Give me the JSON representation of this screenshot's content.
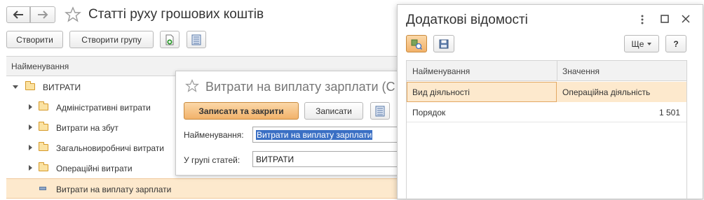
{
  "main": {
    "title": "Статті руху грошових коштів",
    "toolbar": {
      "create_label": "Створити",
      "create_group_label": "Створити групу"
    },
    "column_header": "Найменування",
    "tree": [
      {
        "label": "ВИТРАТИ",
        "type": "group-expanded"
      },
      {
        "label": "Адміністративні витрати",
        "type": "group"
      },
      {
        "label": "Витрати на збут",
        "type": "group"
      },
      {
        "label": "Загальновиробничі витрати",
        "type": "group"
      },
      {
        "label": "Операційні витрати",
        "type": "group"
      },
      {
        "label": "Витрати на виплату зарплати",
        "type": "item",
        "selected": true
      }
    ]
  },
  "item_form": {
    "title": "Витрати на виплату зарплати (С",
    "save_close_label": "Записати та закрити",
    "save_label": "Записати",
    "name_label": "Найменування:",
    "name_value": "Витрати на виплату зарплати",
    "group_label": "У групі статей:",
    "group_value": "ВИТРАТИ"
  },
  "additional_info": {
    "title": "Додаткові відомості",
    "more_label": "Ще",
    "help_label": "?",
    "col_name": "Найменування",
    "col_value": "Значення",
    "rows": [
      {
        "name": "Вид діяльності",
        "value": "Операційна діяльність",
        "selected": true
      },
      {
        "name": "Порядок",
        "value": "1 501",
        "selected": false
      }
    ]
  },
  "colors": {
    "selection": "#fde9cd",
    "accent_button": "#f2b26a",
    "text_selection": "#3a6fc4"
  }
}
